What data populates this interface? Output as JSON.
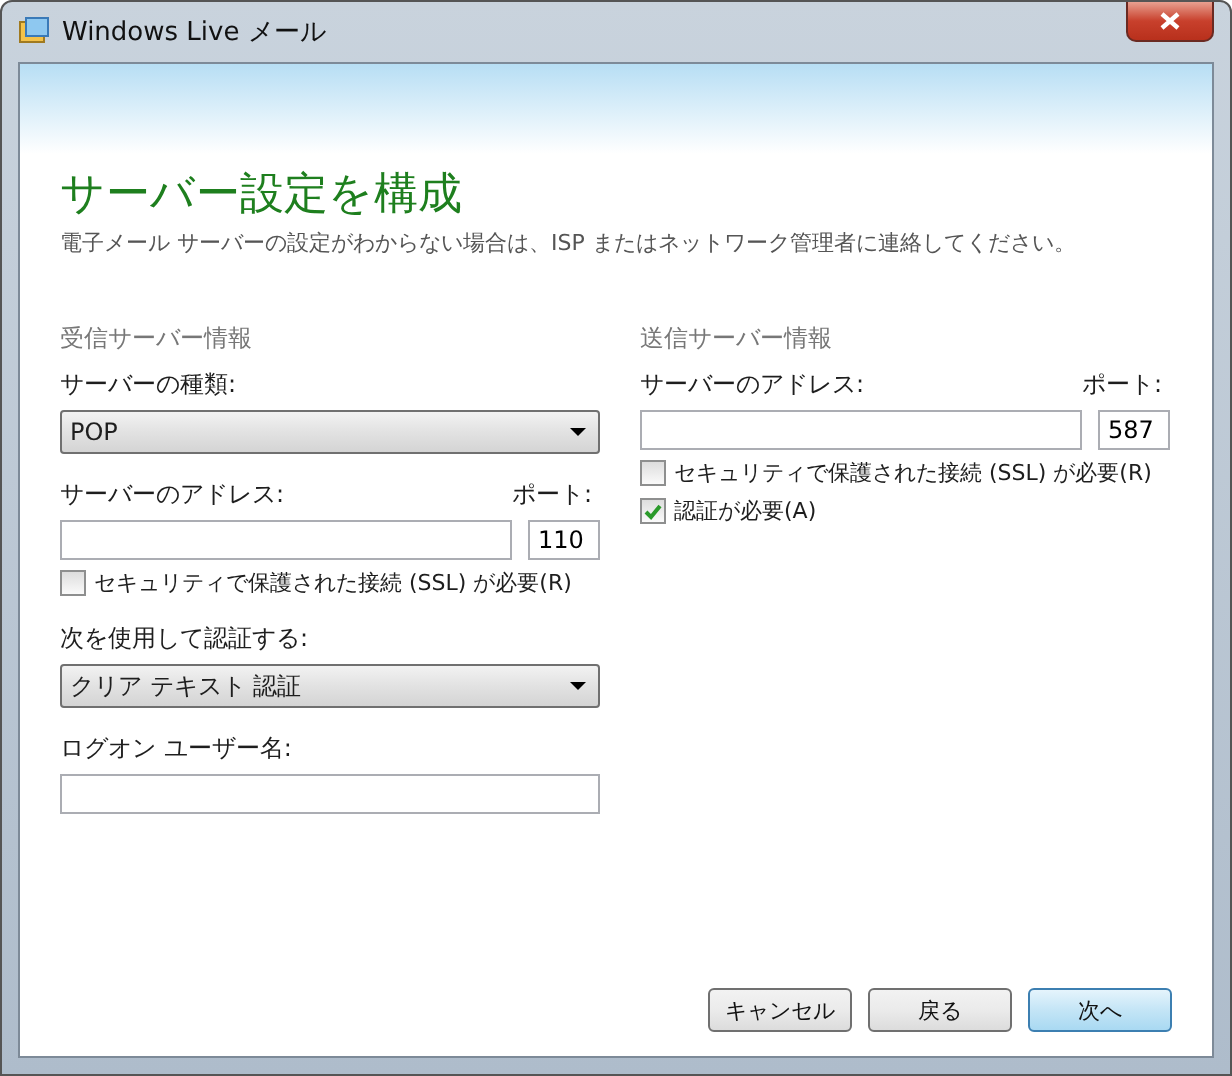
{
  "window": {
    "title": "Windows Live メール"
  },
  "heading": "サーバー設定を構成",
  "subtitle": "電子メール サーバーの設定がわからない場合は、ISP またはネットワーク管理者に連絡してください。",
  "incoming": {
    "title": "受信サーバー情報",
    "type_label": "サーバーの種類:",
    "type_value": "POP",
    "address_label": "サーバーのアドレス:",
    "port_label": "ポート:",
    "port_value": "110",
    "ssl": {
      "label": "セキュリティで保護された接続 (SSL) が必要(R)",
      "checked": false
    },
    "auth_label": "次を使用して認証する:",
    "auth_value": "クリア テキスト 認証",
    "user_label": "ログオン ユーザー名:"
  },
  "outgoing": {
    "title": "送信サーバー情報",
    "address_label": "サーバーのアドレス:",
    "port_label": "ポート:",
    "port_value": "587",
    "checks": [
      {
        "label": "セキュリティで保護された接続 (SSL) が必要(R)",
        "checked": false
      },
      {
        "label": "認証が必要(A)",
        "checked": true
      }
    ]
  },
  "buttons": [
    {
      "label": "キャンセル",
      "default": false
    },
    {
      "label": "戻る",
      "default": false
    },
    {
      "label": "次へ",
      "default": true
    }
  ]
}
